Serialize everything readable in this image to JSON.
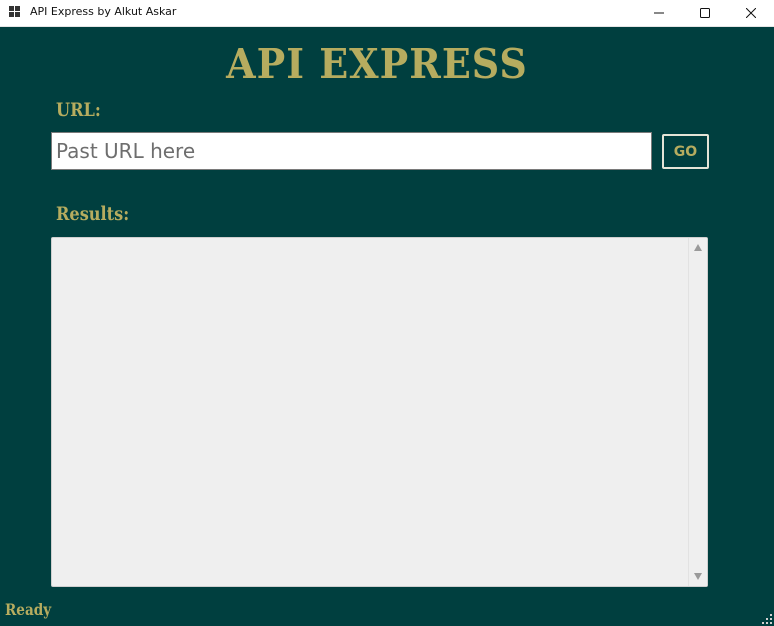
{
  "window": {
    "title": "API Express by Alkut Askar",
    "icon": "app-window-icon",
    "controls": [
      "minimize-icon",
      "maximize-icon",
      "close-icon"
    ]
  },
  "main": {
    "heading": "API EXPRESS",
    "url_label": "URL:",
    "url_input": {
      "value": "",
      "placeholder": "Past URL here"
    },
    "go_button_label": "GO",
    "results_label": "Results:",
    "results_text": ""
  },
  "status": {
    "text": "Ready"
  },
  "colors": {
    "background": "#003f3f",
    "accent_text": "#b6ac5f",
    "results_background": "#efefef",
    "input_background": "#ffffff"
  }
}
